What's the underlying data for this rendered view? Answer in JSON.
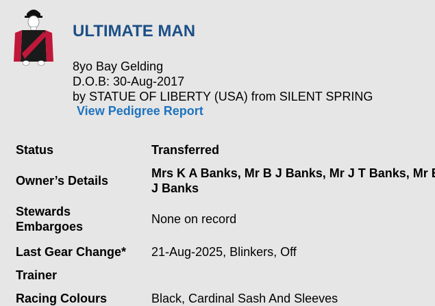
{
  "horse": {
    "name": "ULTIMATE MAN",
    "age_sex": "8yo Bay Gelding",
    "dob": "D.O.B: 30-Aug-2017",
    "breeding": "by STATUE OF LIBERTY (USA)  from SILENT SPRING",
    "pedigree_link": "View Pedigree Report"
  },
  "silks": {
    "icon": "jockey-silks-icon",
    "body_color": "#1a1a1a",
    "sash_color": "#c0183a",
    "sleeve_color": "#c0183a",
    "cap_color": "#111111"
  },
  "details": {
    "status_label": "Status",
    "status_value": "Transferred",
    "owner_label": "Owner’s Details",
    "owner_value": "Mrs K A Banks, Mr B J Banks, Mr J T Banks, Mr B J Banks",
    "stewards_label": "Stewards Embargoes",
    "stewards_value": "None on record",
    "gear_label": "Last Gear Change*",
    "gear_value": "21-Aug-2025, Blinkers, Off",
    "trainer_label": "Trainer",
    "trainer_value": "",
    "colours_label": "Racing Colours",
    "colours_value": "Black, Cardinal Sash And Sleeves"
  }
}
